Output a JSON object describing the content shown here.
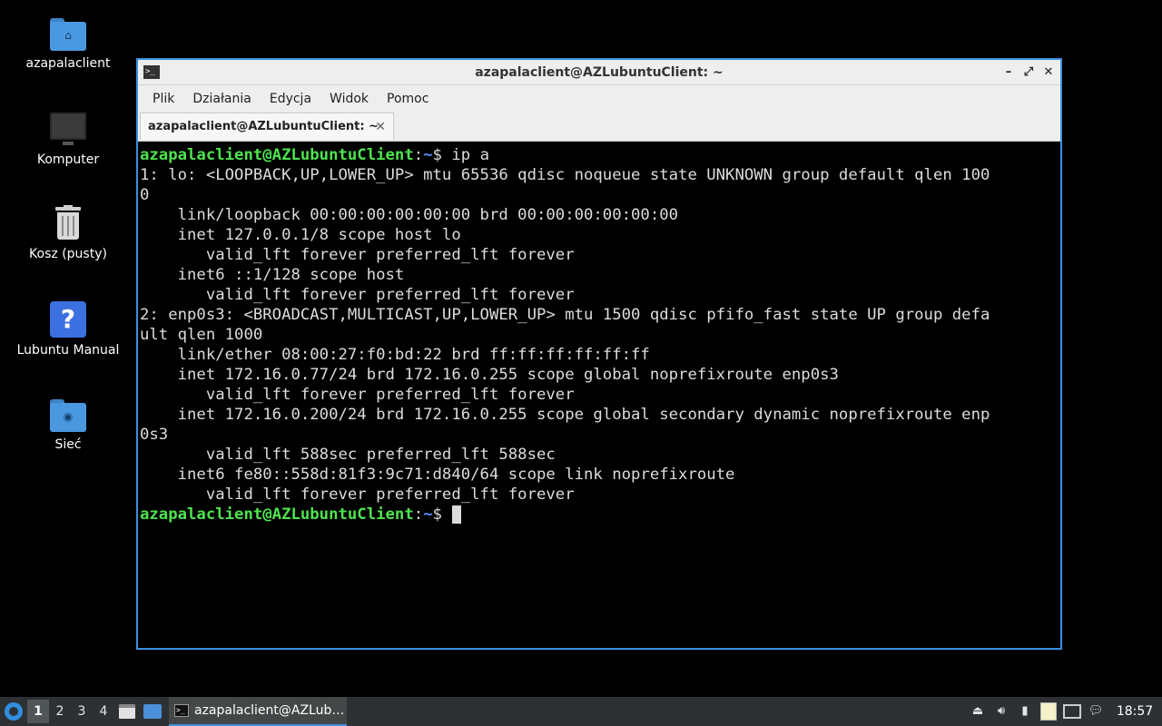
{
  "desktop": {
    "icons": [
      {
        "label": "azapalaclient"
      },
      {
        "label": "Komputer"
      },
      {
        "label": "Kosz (pusty)"
      },
      {
        "label": "Lubuntu Manual"
      },
      {
        "label": "Sieć"
      }
    ]
  },
  "window": {
    "title": "azapalaclient@AZLubuntuClient: ~",
    "app_icon_glyph": ">_",
    "controls": {
      "minimize": "–",
      "maximize": "⤢",
      "close": "✕"
    },
    "menu": [
      "Plik",
      "Działania",
      "Edycja",
      "Widok",
      "Pomoc"
    ],
    "tab": {
      "label": "azapalaclient@AZLubuntuClient: ~",
      "close": "✕"
    }
  },
  "terminal": {
    "prompt_user": "azapalaclient@AZLubuntuClient",
    "prompt_sep": ":",
    "prompt_path": "~",
    "prompt_symbol": "$ ",
    "command": "ip a",
    "output": [
      "1: lo: <LOOPBACK,UP,LOWER_UP> mtu 65536 qdisc noqueue state UNKNOWN group default qlen 100",
      "0",
      "    link/loopback 00:00:00:00:00:00 brd 00:00:00:00:00:00",
      "    inet 127.0.0.1/8 scope host lo",
      "       valid_lft forever preferred_lft forever",
      "    inet6 ::1/128 scope host",
      "       valid_lft forever preferred_lft forever",
      "2: enp0s3: <BROADCAST,MULTICAST,UP,LOWER_UP> mtu 1500 qdisc pfifo_fast state UP group defa",
      "ult qlen 1000",
      "    link/ether 08:00:27:f0:bd:22 brd ff:ff:ff:ff:ff:ff",
      "    inet 172.16.0.77/24 brd 172.16.0.255 scope global noprefixroute enp0s3",
      "       valid_lft forever preferred_lft forever",
      "    inet 172.16.0.200/24 brd 172.16.0.255 scope global secondary dynamic noprefixroute enp",
      "0s3",
      "       valid_lft 588sec preferred_lft 588sec",
      "    inet6 fe80::558d:81f3:9c71:d840/64 scope link noprefixroute",
      "       valid_lft forever preferred_lft forever"
    ]
  },
  "taskbar": {
    "workspaces": [
      "1",
      "2",
      "3",
      "4"
    ],
    "active_workspace": "1",
    "task_label": "azapalaclient@AZLub…",
    "clock": "18:57"
  },
  "colors": {
    "prompt_user": "#4ee44e",
    "prompt_path": "#5a8cff",
    "window_border": "#3b8fe0",
    "taskbar_bg": "#2d3134"
  }
}
